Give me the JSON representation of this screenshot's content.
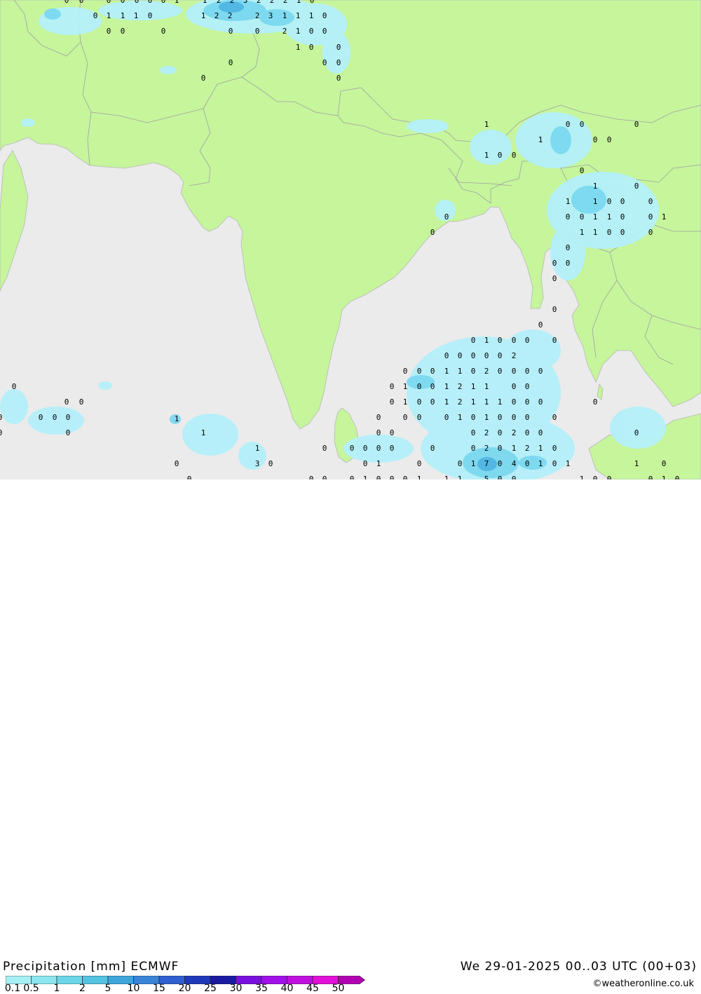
{
  "header": {
    "title": "Precipitation [mm] ECMWF",
    "datetime": "We 29-01-2025 00..03 UTC (00+03)"
  },
  "credit": "©weatheronline.co.uk",
  "colors": {
    "land": "#c6f59c",
    "sea": "#ebebeb",
    "border": "#a0a0a0",
    "rain_light": "#b4f0fa",
    "rain_mid": "#78d7ef",
    "rain_heavy": "#4ab0e0"
  },
  "legend": {
    "labels": [
      "0.1",
      "0.5",
      "1",
      "2",
      "5",
      "10",
      "15",
      "20",
      "25",
      "30",
      "35",
      "40",
      "45",
      "50"
    ],
    "colors": [
      "#a6f0f5",
      "#8be6ef",
      "#6cd6e8",
      "#52c3e0",
      "#3fa5dc",
      "#3a84d8",
      "#2f5fd0",
      "#1f3ab8",
      "#1a1aa0",
      "#7a10e0",
      "#a010e8",
      "#c010e0",
      "#e010d8",
      "#b000b0"
    ]
  },
  "precip_values": [
    [
      "0",
      95,
      0
    ],
    [
      "0",
      116,
      0
    ],
    [
      "0",
      155,
      0
    ],
    [
      "0",
      175,
      0
    ],
    [
      "0",
      195,
      0
    ],
    [
      "0",
      214,
      0
    ],
    [
      "0",
      233,
      0
    ],
    [
      "1",
      252,
      0
    ],
    [
      "1",
      292,
      0
    ],
    [
      "2",
      312,
      0
    ],
    [
      "2",
      331,
      0
    ],
    [
      "3",
      350,
      0
    ],
    [
      "2",
      369,
      0
    ],
    [
      "2",
      388,
      0
    ],
    [
      "2",
      407,
      0
    ],
    [
      "1",
      426,
      0
    ],
    [
      "0",
      445,
      0
    ],
    [
      "0",
      136,
      22
    ],
    [
      "1",
      155,
      22
    ],
    [
      "1",
      175,
      22
    ],
    [
      "1",
      194,
      22
    ],
    [
      "0",
      214,
      22
    ],
    [
      "1",
      290,
      22
    ],
    [
      "2",
      309,
      22
    ],
    [
      "2",
      328,
      22
    ],
    [
      "2",
      367,
      22
    ],
    [
      "3",
      386,
      22
    ],
    [
      "1",
      406,
      22
    ],
    [
      "1",
      425,
      22
    ],
    [
      "1",
      444,
      22
    ],
    [
      "0",
      463,
      22
    ],
    [
      "0",
      155,
      44
    ],
    [
      "0",
      175,
      44
    ],
    [
      "0",
      233,
      44
    ],
    [
      "0",
      329,
      44
    ],
    [
      "0",
      367,
      44
    ],
    [
      "2",
      406,
      44
    ],
    [
      "1",
      425,
      44
    ],
    [
      "0",
      444,
      44
    ],
    [
      "0",
      463,
      44
    ],
    [
      "1",
      425,
      67
    ],
    [
      "0",
      444,
      67
    ],
    [
      "0",
      483,
      67
    ],
    [
      "0",
      329,
      89
    ],
    [
      "0",
      463,
      89
    ],
    [
      "0",
      483,
      89
    ],
    [
      "0",
      290,
      111
    ],
    [
      "0",
      483,
      111
    ],
    [
      "1",
      694,
      177
    ],
    [
      "0",
      810,
      177
    ],
    [
      "0",
      830,
      177
    ],
    [
      "0",
      908,
      177
    ],
    [
      "1",
      771,
      199
    ],
    [
      "0",
      849,
      199
    ],
    [
      "0",
      869,
      199
    ],
    [
      "1",
      694,
      221
    ],
    [
      "0",
      713,
      221
    ],
    [
      "0",
      733,
      221
    ],
    [
      "0",
      830,
      243
    ],
    [
      "1",
      849,
      265
    ],
    [
      "0",
      908,
      265
    ],
    [
      "1",
      810,
      287
    ],
    [
      "1",
      849,
      287
    ],
    [
      "0",
      869,
      287
    ],
    [
      "0",
      888,
      287
    ],
    [
      "0",
      928,
      287
    ],
    [
      "0",
      637,
      309
    ],
    [
      "0",
      810,
      309
    ],
    [
      "0",
      830,
      309
    ],
    [
      "1",
      849,
      309
    ],
    [
      "1",
      869,
      309
    ],
    [
      "0",
      888,
      309
    ],
    [
      "0",
      928,
      309
    ],
    [
      "1",
      947,
      309
    ],
    [
      "0",
      617,
      331
    ],
    [
      "1",
      830,
      331
    ],
    [
      "1",
      849,
      331
    ],
    [
      "0",
      869,
      331
    ],
    [
      "0",
      888,
      331
    ],
    [
      "0",
      928,
      331
    ],
    [
      "0",
      810,
      353
    ],
    [
      "0",
      791,
      375
    ],
    [
      "0",
      810,
      375
    ],
    [
      "0",
      791,
      397
    ],
    [
      "0",
      791,
      441
    ],
    [
      "0",
      771,
      463
    ],
    [
      "0",
      675,
      485
    ],
    [
      "1",
      694,
      485
    ],
    [
      "0",
      713,
      485
    ],
    [
      "0",
      733,
      485
    ],
    [
      "0",
      752,
      485
    ],
    [
      "0",
      791,
      485
    ],
    [
      "0",
      637,
      507
    ],
    [
      "0",
      656,
      507
    ],
    [
      "0",
      675,
      507
    ],
    [
      "0",
      694,
      507
    ],
    [
      "0",
      713,
      507
    ],
    [
      "2",
      733,
      507
    ],
    [
      "0",
      578,
      529
    ],
    [
      "0",
      598,
      529
    ],
    [
      "0",
      617,
      529
    ],
    [
      "1",
      637,
      529
    ],
    [
      "1",
      656,
      529
    ],
    [
      "0",
      675,
      529
    ],
    [
      "2",
      694,
      529
    ],
    [
      "0",
      713,
      529
    ],
    [
      "0",
      733,
      529
    ],
    [
      "0",
      752,
      529
    ],
    [
      "0",
      771,
      529
    ],
    [
      "0",
      20,
      551
    ],
    [
      "0",
      559,
      551
    ],
    [
      "1",
      578,
      551
    ],
    [
      "0",
      598,
      551
    ],
    [
      "0",
      617,
      551
    ],
    [
      "1",
      637,
      551
    ],
    [
      "2",
      656,
      551
    ],
    [
      "1",
      675,
      551
    ],
    [
      "1",
      694,
      551
    ],
    [
      "0",
      733,
      551
    ],
    [
      "0",
      752,
      551
    ],
    [
      "0",
      95,
      573
    ],
    [
      "0",
      116,
      573
    ],
    [
      "0",
      559,
      573
    ],
    [
      "1",
      578,
      573
    ],
    [
      "0",
      598,
      573
    ],
    [
      "0",
      617,
      573
    ],
    [
      "1",
      637,
      573
    ],
    [
      "2",
      656,
      573
    ],
    [
      "1",
      675,
      573
    ],
    [
      "1",
      694,
      573
    ],
    [
      "1",
      713,
      573
    ],
    [
      "0",
      733,
      573
    ],
    [
      "0",
      752,
      573
    ],
    [
      "0",
      771,
      573
    ],
    [
      "0",
      849,
      573
    ],
    [
      "0",
      0,
      595
    ],
    [
      "0",
      58,
      595
    ],
    [
      "0",
      78,
      595
    ],
    [
      "0",
      97,
      595
    ],
    [
      "0",
      540,
      595
    ],
    [
      "0",
      578,
      595
    ],
    [
      "0",
      598,
      595
    ],
    [
      "0",
      637,
      595
    ],
    [
      "1",
      656,
      595
    ],
    [
      "0",
      675,
      595
    ],
    [
      "1",
      694,
      595
    ],
    [
      "0",
      713,
      595
    ],
    [
      "0",
      733,
      595
    ],
    [
      "0",
      752,
      595
    ],
    [
      "0",
      791,
      595
    ],
    [
      "1",
      252,
      597
    ],
    [
      "0",
      0,
      617
    ],
    [
      "0",
      97,
      617
    ],
    [
      "1",
      290,
      617
    ],
    [
      "0",
      540,
      617
    ],
    [
      "0",
      559,
      617
    ],
    [
      "0",
      675,
      617
    ],
    [
      "2",
      694,
      617
    ],
    [
      "0",
      713,
      617
    ],
    [
      "2",
      733,
      617
    ],
    [
      "0",
      752,
      617
    ],
    [
      "0",
      771,
      617
    ],
    [
      "0",
      908,
      617
    ],
    [
      "1",
      367,
      639
    ],
    [
      "0",
      463,
      639
    ],
    [
      "0",
      502,
      639
    ],
    [
      "0",
      521,
      639
    ],
    [
      "0",
      540,
      639
    ],
    [
      "0",
      559,
      639
    ],
    [
      "0",
      617,
      639
    ],
    [
      "0",
      675,
      639
    ],
    [
      "2",
      694,
      639
    ],
    [
      "0",
      713,
      639
    ],
    [
      "1",
      733,
      639
    ],
    [
      "2",
      752,
      639
    ],
    [
      "1",
      771,
      639
    ],
    [
      "0",
      791,
      639
    ],
    [
      "0",
      252,
      661
    ],
    [
      "3",
      367,
      661
    ],
    [
      "0",
      386,
      661
    ],
    [
      "0",
      521,
      661
    ],
    [
      "1",
      540,
      661
    ],
    [
      "0",
      598,
      661
    ],
    [
      "0",
      656,
      661
    ],
    [
      "1",
      675,
      661
    ],
    [
      "7",
      694,
      661
    ],
    [
      "0",
      713,
      661
    ],
    [
      "4",
      733,
      661
    ],
    [
      "0",
      752,
      661
    ],
    [
      "1",
      771,
      661
    ],
    [
      "0",
      791,
      661
    ],
    [
      "1",
      810,
      661
    ],
    [
      "1",
      908,
      661
    ],
    [
      "0",
      947,
      661
    ],
    [
      "0",
      270,
      683
    ],
    [
      "0",
      444,
      683
    ],
    [
      "0",
      463,
      683
    ],
    [
      "0",
      502,
      683
    ],
    [
      "1",
      521,
      683
    ],
    [
      "0",
      540,
      683
    ],
    [
      "0",
      559,
      683
    ],
    [
      "0",
      578,
      683
    ],
    [
      "1",
      598,
      683
    ],
    [
      "1",
      637,
      683
    ],
    [
      "1",
      656,
      683
    ],
    [
      "5",
      694,
      683
    ],
    [
      "0",
      713,
      683
    ],
    [
      "0",
      733,
      683
    ],
    [
      "1",
      830,
      683
    ],
    [
      "0",
      849,
      683
    ],
    [
      "0",
      869,
      683
    ],
    [
      "0",
      928,
      683
    ],
    [
      "1",
      947,
      683
    ],
    [
      "0",
      966,
      683
    ]
  ]
}
